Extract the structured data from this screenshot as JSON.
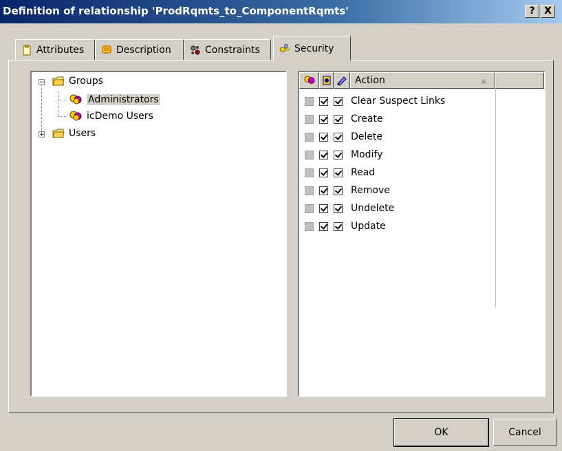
{
  "window": {
    "title": "Definition of relationship 'ProdRqmts_to_ComponentRqmts'",
    "help_glyph": "?",
    "close_glyph": "X"
  },
  "tabs": [
    {
      "label": "Attributes",
      "icon": "clipboard-icon"
    },
    {
      "label": "Description",
      "icon": "note-icon"
    },
    {
      "label": "Constraints",
      "icon": "constraints-icon"
    },
    {
      "label": "Security",
      "icon": "keys-icon",
      "active": true
    }
  ],
  "tree": {
    "nodes": [
      {
        "label": "Groups",
        "icon": "folder-icon",
        "expander": "−"
      },
      {
        "label": "Administrators",
        "icon": "user-group-icon",
        "selected": true
      },
      {
        "label": "icDemo Users",
        "icon": "user-group-icon"
      },
      {
        "label": "Users",
        "icon": "folder-icon",
        "expander": "+"
      }
    ]
  },
  "actions": {
    "header": {
      "action_label": "Action",
      "sort_glyph": "▲"
    },
    "rows": [
      {
        "label": "Clear Suspect Links",
        "checks": [
          false,
          true,
          true
        ]
      },
      {
        "label": "Create",
        "checks": [
          false,
          true,
          true
        ]
      },
      {
        "label": "Delete",
        "checks": [
          false,
          true,
          true
        ]
      },
      {
        "label": "Modify",
        "checks": [
          false,
          true,
          true
        ]
      },
      {
        "label": "Read",
        "checks": [
          false,
          true,
          true
        ]
      },
      {
        "label": "Remove",
        "checks": [
          false,
          true,
          true
        ]
      },
      {
        "label": "Undelete",
        "checks": [
          false,
          true,
          true
        ]
      },
      {
        "label": "Update",
        "checks": [
          false,
          true,
          true
        ]
      }
    ]
  },
  "buttons": {
    "ok": "OK",
    "cancel": "Cancel"
  }
}
